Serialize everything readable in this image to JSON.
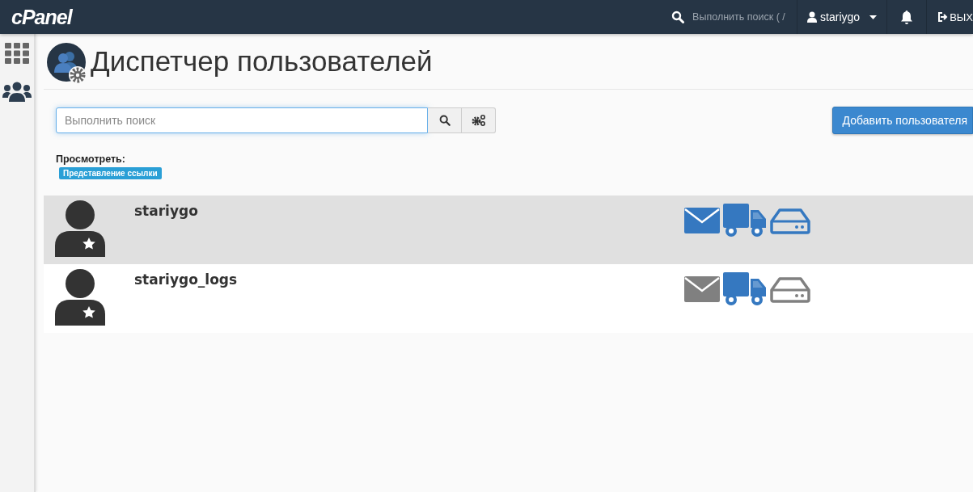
{
  "topbar": {
    "logo": "cPanel",
    "search": {
      "placeholder": "Выполнить поиск ( /"
    },
    "user": "stariygo",
    "logout": "ВЫХ"
  },
  "page": {
    "title": "Диспетчер пользователей"
  },
  "search": {
    "placeholder": "Выполнить поиск"
  },
  "add_button": "Добавить пользователя",
  "view": {
    "label": "Просмотреть:",
    "badge": "Представление ссылки"
  },
  "users": [
    {
      "name": "stariygo",
      "selected": true,
      "services": [
        {
          "kind": "email",
          "enabled": true
        },
        {
          "kind": "ftp",
          "enabled": true
        },
        {
          "kind": "disk",
          "enabled": true
        }
      ]
    },
    {
      "name": "stariygo_logs",
      "selected": false,
      "services": [
        {
          "kind": "email",
          "enabled": false
        },
        {
          "kind": "ftp",
          "enabled": true
        },
        {
          "kind": "disk",
          "enabled": false
        }
      ]
    }
  ]
}
